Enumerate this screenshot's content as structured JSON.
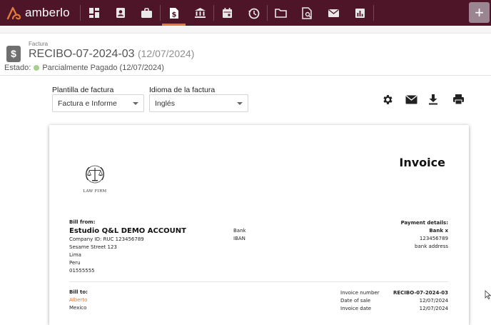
{
  "app": {
    "name": "amberlo"
  },
  "nav": {
    "items": [
      {
        "icon": "dashboard-icon",
        "name": "nav-dashboard"
      },
      {
        "icon": "contacts-icon",
        "name": "nav-contacts"
      },
      {
        "icon": "briefcase-icon",
        "name": "nav-matters"
      },
      {
        "icon": "invoice-icon",
        "name": "nav-invoices",
        "active": true
      },
      {
        "icon": "bank-icon",
        "name": "nav-banking"
      },
      {
        "icon": "calendar-icon",
        "name": "nav-calendar"
      },
      {
        "icon": "time-entry-icon",
        "name": "nav-time"
      },
      {
        "icon": "folder-icon",
        "name": "nav-documents"
      },
      {
        "icon": "search-document-icon",
        "name": "nav-search"
      },
      {
        "icon": "mail-icon",
        "name": "nav-mail"
      },
      {
        "icon": "reports-icon",
        "name": "nav-reports"
      }
    ],
    "add_label": "+"
  },
  "header": {
    "breadcrumb": "Factura",
    "title": "RECIBO-07-2024-03",
    "title_date": "(12/07/2024)",
    "status_label": "Estado:",
    "status_value": "Parcialmente Pagado (12/07/2024)",
    "status_color": "#a7cf8e"
  },
  "controls": {
    "template_label": "Plantilla de factura",
    "template_value": "Factura e Informe",
    "language_label": "Idioma de la factura",
    "language_value": "Inglés",
    "tools": [
      "settings-icon",
      "email-icon",
      "download-icon",
      "print-icon"
    ]
  },
  "invoice": {
    "title": "Invoice",
    "logo_text": "LAW FIRM",
    "bill_from": {
      "label": "Bill from:",
      "company": "Estudio Q&L DEMO ACCOUNT",
      "lines": [
        "Company ID: RUC 123456789",
        "Sesame Street 123",
        "Lima",
        "Peru",
        "01555555"
      ]
    },
    "bank": {
      "lines": [
        "Bank",
        "IBAN"
      ]
    },
    "payment": {
      "label": "Payment details:",
      "bank_name": "Bank x",
      "lines": [
        "123456789",
        "bank address"
      ]
    },
    "bill_to": {
      "label": "Bill to:",
      "name": "Alberto",
      "country": "Mexico"
    },
    "meta": {
      "number_label": "Invoice number",
      "number_value": "RECIBO-07-2024-03",
      "sale_label": "Date of sale",
      "sale_value": "12/07/2024",
      "invoice_date_label": "Invoice date",
      "invoice_date_value": "12/07/2024"
    }
  },
  "colors": {
    "topbar": "#4e1428",
    "accent": "#e07a3a"
  }
}
